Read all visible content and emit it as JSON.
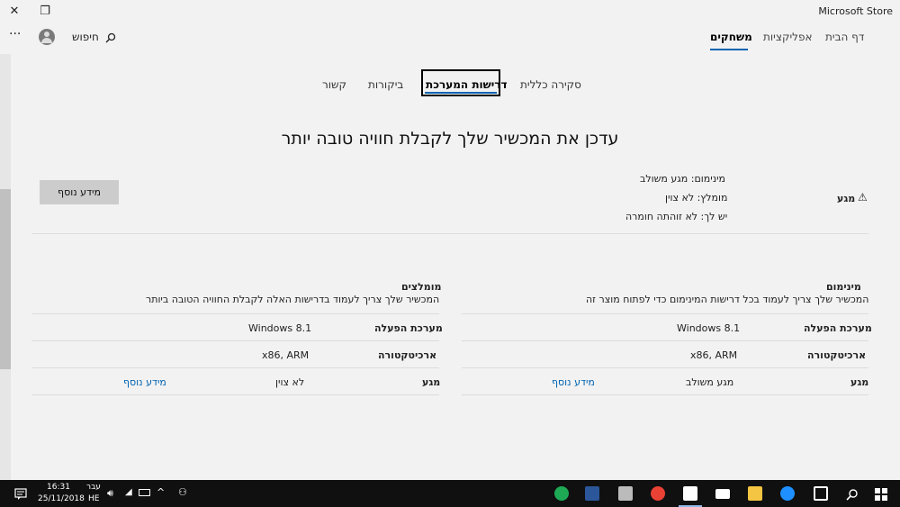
{
  "window": {
    "title": "Microsoft Store",
    "close_glyph": "✕",
    "restore_glyph": "❐",
    "minimize_glyph": "—"
  },
  "nav": {
    "tabs": [
      {
        "label": "דף הבית"
      },
      {
        "label": "אפליקציות"
      },
      {
        "label": "משחקים"
      }
    ],
    "active_tab": "משחקים",
    "search_label": "חיפוש",
    "more_glyph": "···",
    "accent_color": "#0063b1"
  },
  "subtabs": [
    {
      "label": "סקירה כללית"
    },
    {
      "label": "דרישות המערכת"
    },
    {
      "label": "ביקורות"
    },
    {
      "label": "קשור"
    }
  ],
  "heading": "עדכן את המכשיר שלך לקבלת חוויה טובה יותר",
  "touch_summary": {
    "label": "מגע",
    "warning_glyph": "⚠",
    "lines": [
      "מינימום: מגע משולב",
      "מומלץ: לא צוין",
      "יש לך: לא זוהתה חומרה"
    ],
    "more_button": "מידע נוסף"
  },
  "minimum": {
    "title": "מינימום",
    "subtitle": "המכשיר שלך צריך לעמוד בכל דרישות המינימום כדי לפתוח מוצר זה",
    "rows": [
      {
        "label": "מערכת הפעלה",
        "value": "Windows 8.1",
        "link": ""
      },
      {
        "label": "ארכיטקטורה",
        "value": "x86, ARM",
        "link": ""
      },
      {
        "label": "מגע",
        "value": "מגע משולב",
        "link": "מידע נוסף"
      }
    ]
  },
  "recommended": {
    "title": "מומלצים",
    "subtitle": "המכשיר שלך צריך לעמוד בדרישות האלה לקבלת החוויה הטובה ביותר",
    "rows": [
      {
        "label": "מערכת הפעלה",
        "value": "Windows 8.1",
        "link": ""
      },
      {
        "label": "ארכיטקטורה",
        "value": "x86, ARM",
        "link": ""
      },
      {
        "label": "מגע",
        "value": "לא צוין",
        "link": "מידע נוסף"
      }
    ]
  },
  "taskbar": {
    "time": "16:31",
    "date": "25/11/2018",
    "language_top": "עבר",
    "language_bottom": "HE",
    "apps": [
      {
        "icon": "windows-start-icon",
        "color": "#ffffff"
      },
      {
        "icon": "search-icon",
        "color": "#ffffff"
      },
      {
        "icon": "task-view-icon",
        "color": "#ffffff"
      },
      {
        "icon": "edge-icon",
        "color": "#1e90ff"
      },
      {
        "icon": "folder-icon",
        "color": "#f4c542"
      },
      {
        "icon": "mail-icon",
        "color": "#ffffff"
      },
      {
        "icon": "store-icon",
        "color": "#ffffff"
      },
      {
        "icon": "chrome-icon",
        "color": "#e94235"
      },
      {
        "icon": "photos-icon",
        "color": "#bbbbbb"
      },
      {
        "icon": "word-icon",
        "color": "#2b579a"
      },
      {
        "icon": "edge-legacy-icon",
        "color": "#1eaa55"
      }
    ]
  }
}
